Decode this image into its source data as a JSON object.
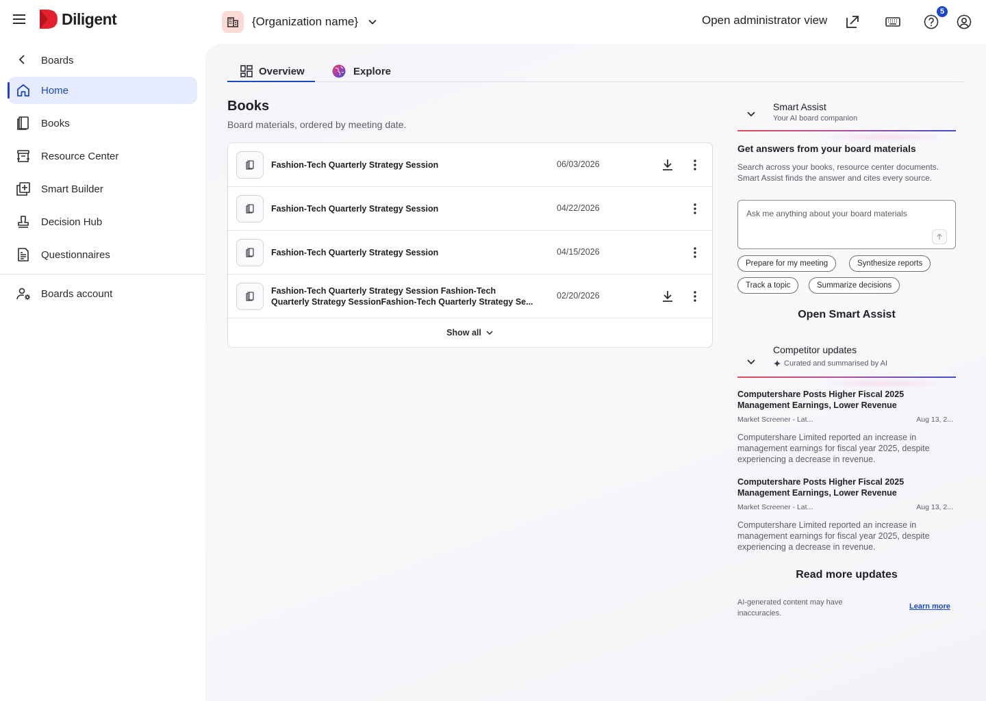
{
  "app": {
    "logo_text": "Diligent"
  },
  "header": {
    "org_name": "{Organization name}",
    "admin_view_label": "Open administrator view",
    "help_badge_count": "5"
  },
  "sidebar": {
    "back_label": "Boards",
    "items": [
      {
        "label": "Home",
        "icon": "home-icon",
        "active": true
      },
      {
        "label": "Books",
        "icon": "book-icon"
      },
      {
        "label": "Resource Center",
        "icon": "archive-icon"
      },
      {
        "label": "Smart Builder",
        "icon": "smart-builder-icon"
      },
      {
        "label": "Decision Hub",
        "icon": "stamp-icon"
      },
      {
        "label": "Questionnaires",
        "icon": "document-icon"
      }
    ],
    "account_label": "Boards account"
  },
  "tabs": [
    {
      "label": "Overview",
      "icon": "dashboard-icon",
      "active": true
    },
    {
      "label": "Explore",
      "icon": "globe-icon"
    }
  ],
  "books": {
    "title": "Books",
    "subtitle": "Board materials, ordered by meeting date.",
    "rows": [
      {
        "name": "Fashion-Tech Quarterly Strategy Session",
        "date": "06/03/2026",
        "downloadable": true
      },
      {
        "name": "Fashion-Tech Quarterly Strategy Session",
        "date": "04/22/2026",
        "downloadable": false
      },
      {
        "name": "Fashion-Tech Quarterly Strategy Session",
        "date": "04/15/2026",
        "downloadable": false
      },
      {
        "name_line1": "Fashion-Tech Quarterly Strategy Session  Fashion-Tech",
        "name_line2": "Quarterly Strategy SessionFashion-Tech Quarterly Strategy Se...",
        "date": "02/20/2026",
        "downloadable": true
      }
    ],
    "show_all_label": "Show all"
  },
  "smart_assist": {
    "title": "Smart Assist",
    "subtitle": "Your AI board companion",
    "heading": "Get answers from your board materials",
    "description": "Search across your books, resource center documents. Smart Assist finds the answer and cites every source.",
    "input_placeholder": "Ask me anything about your board materials",
    "chips": [
      "Prepare for my meeting",
      "Synthesize reports",
      "Track a topic",
      "Summarize decisions"
    ],
    "open_label": "Open Smart Assist"
  },
  "competitor_updates": {
    "title": "Competitor updates",
    "subtitle": "Curated and summarised by AI",
    "items": [
      {
        "title": "Computershare Posts Higher Fiscal 2025 Management Earnings, Lower Revenue",
        "source": "Market Screener - Lat...",
        "date": "Aug 13, 2...",
        "summary": "Computershare Limited reported an increase in management earnings for fiscal year 2025, despite experiencing a decrease in revenue."
      },
      {
        "title": "Computershare Posts Higher Fiscal 2025 Management Earnings, Lower Revenue",
        "source": "Market Screener - Lat...",
        "date": "Aug 13, 2...",
        "summary": "Computershare Limited reported an increase in management earnings for fiscal year 2025, despite experiencing a decrease in revenue."
      }
    ],
    "read_more_label": "Read more updates"
  },
  "footer": {
    "disclaimer": "AI-generated content may have inaccuracies.",
    "learn_more": "Learn more"
  },
  "colors": {
    "accent": "#1a47c9",
    "brand_red": "#e4202e",
    "active_nav_bg": "#e6ecfd"
  }
}
